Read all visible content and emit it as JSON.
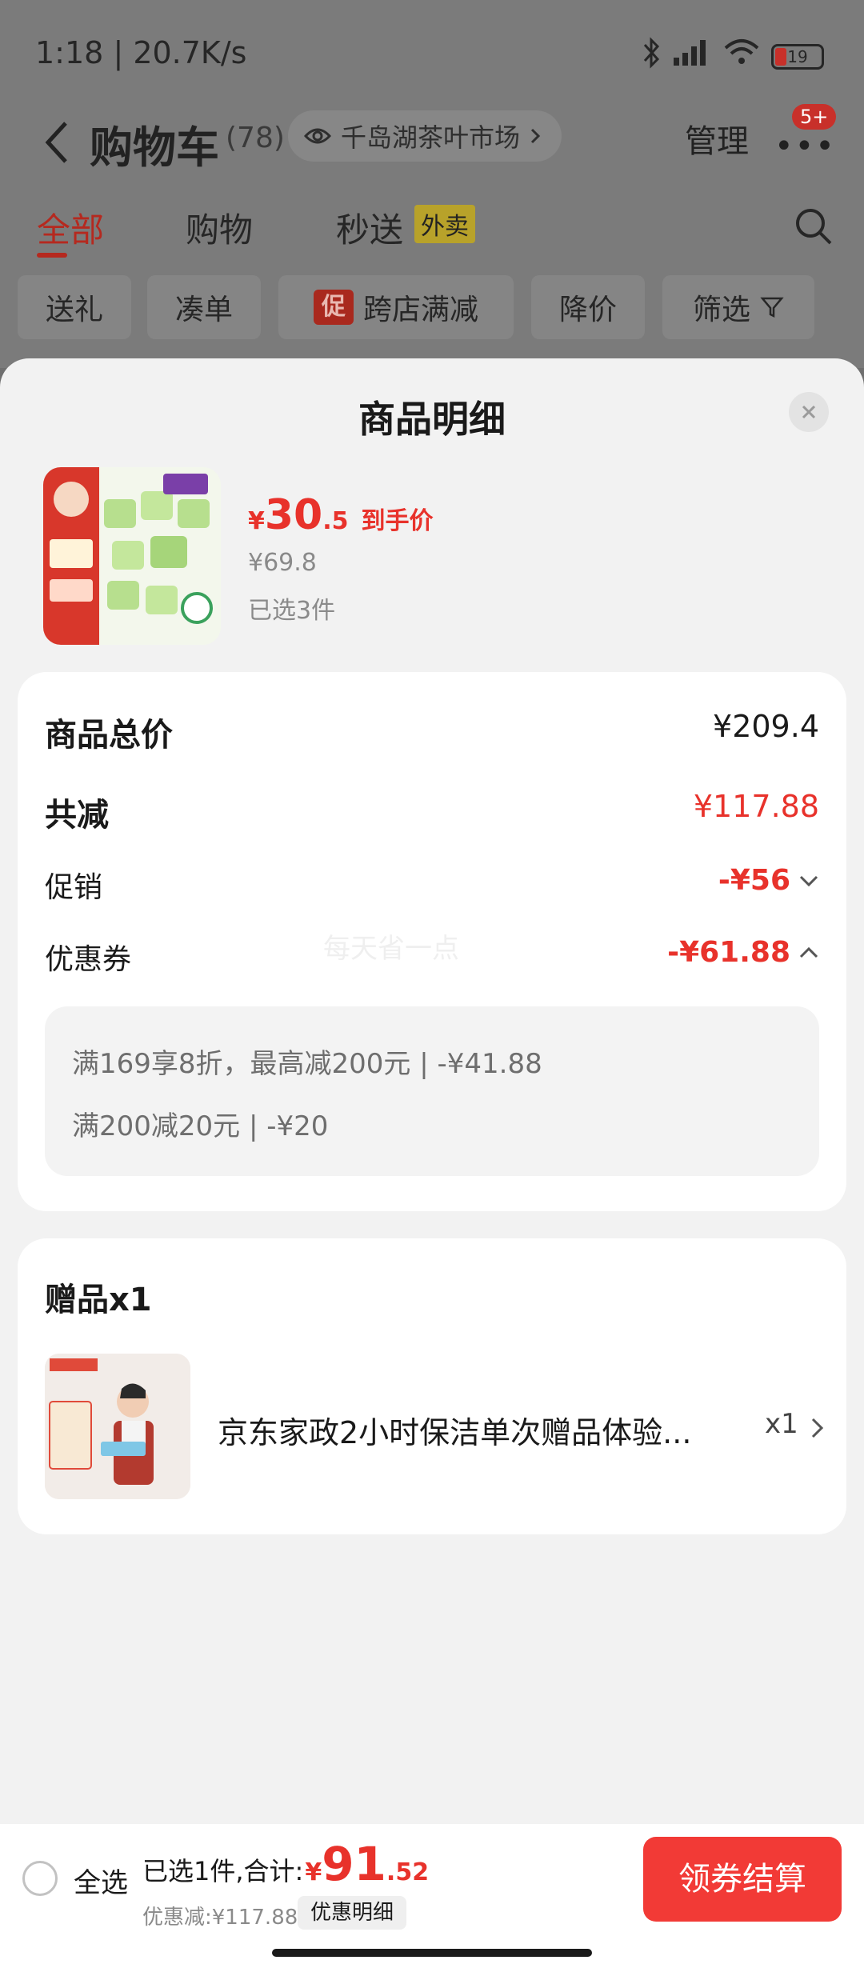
{
  "status_bar": {
    "time": "1:18",
    "speed": "| 20.7K/s",
    "battery": "19"
  },
  "header": {
    "title": "购物车",
    "count": "(78)",
    "store": "千岛湖茶叶市场",
    "manage": "管理",
    "more_badge": "5+"
  },
  "tabs": [
    {
      "label": "全部"
    },
    {
      "label": "购物"
    },
    {
      "label": "秒送"
    }
  ],
  "waimai_tag": "外卖",
  "chips": {
    "gift": "送礼",
    "bundle": "凑单",
    "promo_badge": "促",
    "cross_store": "跨店满减",
    "price_drop": "降价",
    "filter": "筛选"
  },
  "sheet": {
    "title": "商品明细",
    "product": {
      "currency": "¥",
      "price_int": "30",
      "price_dec": ".5",
      "price_tag": "到手价",
      "original_price": "¥69.8",
      "selected": "已选3件"
    },
    "summary": {
      "total_label": "商品总价",
      "total_value": "¥209.4",
      "reduce_label": "共减",
      "reduce_value": "¥117.88",
      "promo_label": "促销",
      "promo_value": "-¥56",
      "coupon_label": "优惠券",
      "coupon_value": "-¥61.88",
      "coupon_details": [
        "满169享8折，最高减200元 | -¥41.88",
        "满200减20元 | -¥20"
      ]
    },
    "watermark": "每天省一点",
    "gift": {
      "title": "赠品x1",
      "name": "京东家政2小时保洁单次赠品体验...",
      "qty": "x1"
    }
  },
  "bottom_bar": {
    "select_all": "全选",
    "total_label": "已选1件,合计:",
    "currency": "¥",
    "total_int": "91",
    "total_dec": ".52",
    "discount": "优惠减:¥117.88",
    "detail_button": "优惠明细",
    "checkout": "领券结算"
  },
  "colors": {
    "accent_red": "#e8322b",
    "checkout_red": "#f23a36"
  }
}
